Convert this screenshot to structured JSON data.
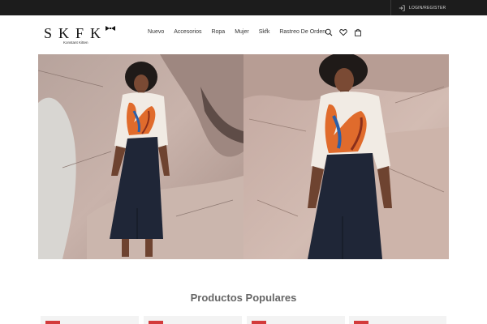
{
  "topbar": {
    "login_label": "LOGIN/REGISTER",
    "bg": "#1c1c1c"
  },
  "header": {
    "logo_text": "SKFK",
    "logo_sub": "Konstant Kitten",
    "nav": [
      "Nuevo",
      "Accesorios",
      "Ropa",
      "Mujer",
      "Skfk",
      "Rastreo De Orden"
    ],
    "icons": [
      "search-icon",
      "heart-icon",
      "bag-icon"
    ]
  },
  "section": {
    "title": "Productos Populares"
  },
  "colors": {
    "badge": "#d33b3b"
  }
}
